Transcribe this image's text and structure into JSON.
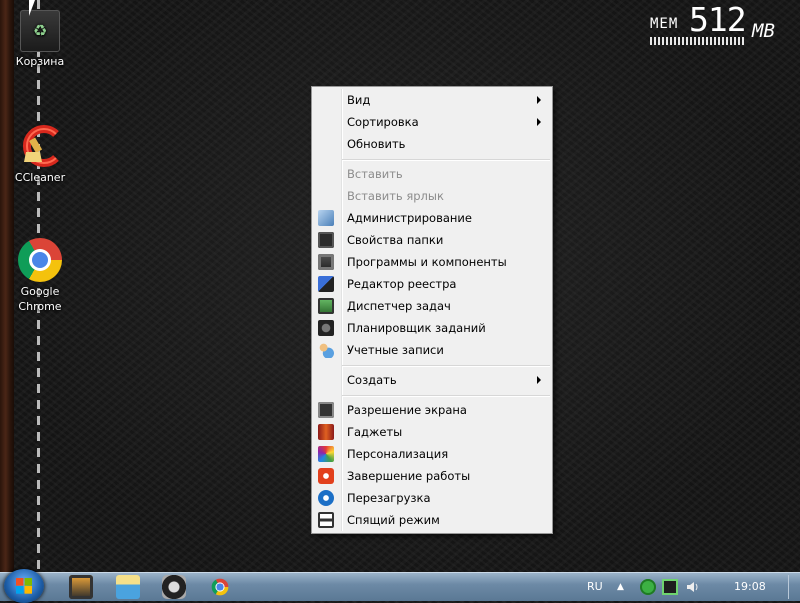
{
  "desktop": {
    "icons": [
      {
        "label": "Корзина",
        "icon": "recycle-bin-icon"
      },
      {
        "label": "CCleaner",
        "icon": "ccleaner-icon"
      },
      {
        "label": "Google\nChrome",
        "label_line1": "Google",
        "label_line2": "Chrome",
        "icon": "chrome-icon"
      }
    ]
  },
  "memory_meter": {
    "label": "MEM",
    "value": "512",
    "unit": "MB"
  },
  "context_menu": {
    "items": [
      {
        "label": "Вид",
        "submenu": true
      },
      {
        "label": "Сортировка",
        "submenu": true
      },
      {
        "label": "Обновить"
      },
      {
        "label": "Вставить",
        "disabled": true
      },
      {
        "label": "Вставить ярлык",
        "disabled": true
      },
      {
        "label": "Администрирование",
        "icon": "admin-tools-icon"
      },
      {
        "label": "Свойства папки",
        "icon": "folder-options-icon"
      },
      {
        "label": "Программы и компоненты",
        "icon": "programs-features-icon"
      },
      {
        "label": "Редактор реестра",
        "icon": "registry-editor-icon"
      },
      {
        "label": "Диспетчер задач",
        "icon": "task-manager-icon"
      },
      {
        "label": "Планировщик заданий",
        "icon": "task-scheduler-icon"
      },
      {
        "label": "Учетные записи",
        "icon": "user-accounts-icon"
      },
      {
        "label": "Создать",
        "submenu": true
      },
      {
        "label": "Разрешение экрана",
        "icon": "screen-resolution-icon"
      },
      {
        "label": "Гаджеты",
        "icon": "gadgets-icon"
      },
      {
        "label": "Персонализация",
        "icon": "personalization-icon"
      },
      {
        "label": "Завершение работы",
        "icon": "shutdown-icon"
      },
      {
        "label": "Перезагрузка",
        "icon": "restart-icon"
      },
      {
        "label": "Спящий режим",
        "icon": "sleep-icon"
      }
    ]
  },
  "taskbar": {
    "start": "start-button-icon",
    "pinned": [
      "media-player-icon",
      "explorer-icon",
      "clock-app-icon",
      "chrome-icon"
    ],
    "language": "RU",
    "clock": "19:08"
  },
  "colors": {
    "menu_bg": "#f0f0f0",
    "taskbar_blue": "#6d8aa6"
  }
}
